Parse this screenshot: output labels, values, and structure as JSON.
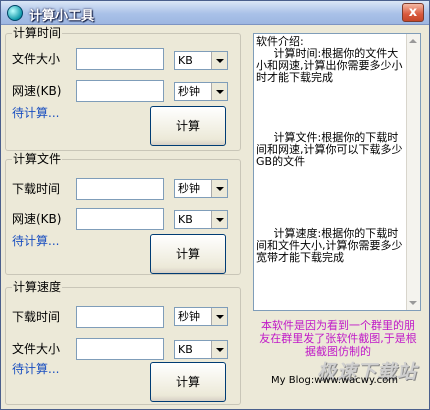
{
  "window": {
    "title": "计算小工具",
    "close_label": "x"
  },
  "groups": [
    {
      "title": "计算时间",
      "fields": [
        {
          "label": "文件大小",
          "value": "",
          "unit": "KB"
        },
        {
          "label": "网速(KB)",
          "value": "",
          "unit": "秒钟"
        }
      ],
      "status": "待计算...",
      "button": "计算"
    },
    {
      "title": "计算文件",
      "fields": [
        {
          "label": "下载时间",
          "value": "",
          "unit": "秒钟"
        },
        {
          "label": "网速(KB)",
          "value": "",
          "unit": "KB"
        }
      ],
      "status": "待计算...",
      "button": "计算"
    },
    {
      "title": "计算速度",
      "fields": [
        {
          "label": "下载时间",
          "value": "",
          "unit": "秒钟"
        },
        {
          "label": "文件大小",
          "value": "",
          "unit": "KB"
        }
      ],
      "status": "待计算...",
      "button": "计算"
    }
  ],
  "info": {
    "text": "软件介绍:\n     计算时间:根据你的文件大小和网速,计算出你需要多少小时才能下载完成\n\n\n\n\n     计算文件:根据你的下载时间和网速,计算你可以下载多少GB的文件\n\n\n\n\n\n     计算速度:根据你的下载时间和文件大小,计算你需要多少宽带才能下载完成"
  },
  "note": "本软件是因为看到一个群里的朋友在群里发了张软件截图,于是根据截图仿制的",
  "blog": "My Blog:www.wacwy.com",
  "watermark": "极速下载站"
}
